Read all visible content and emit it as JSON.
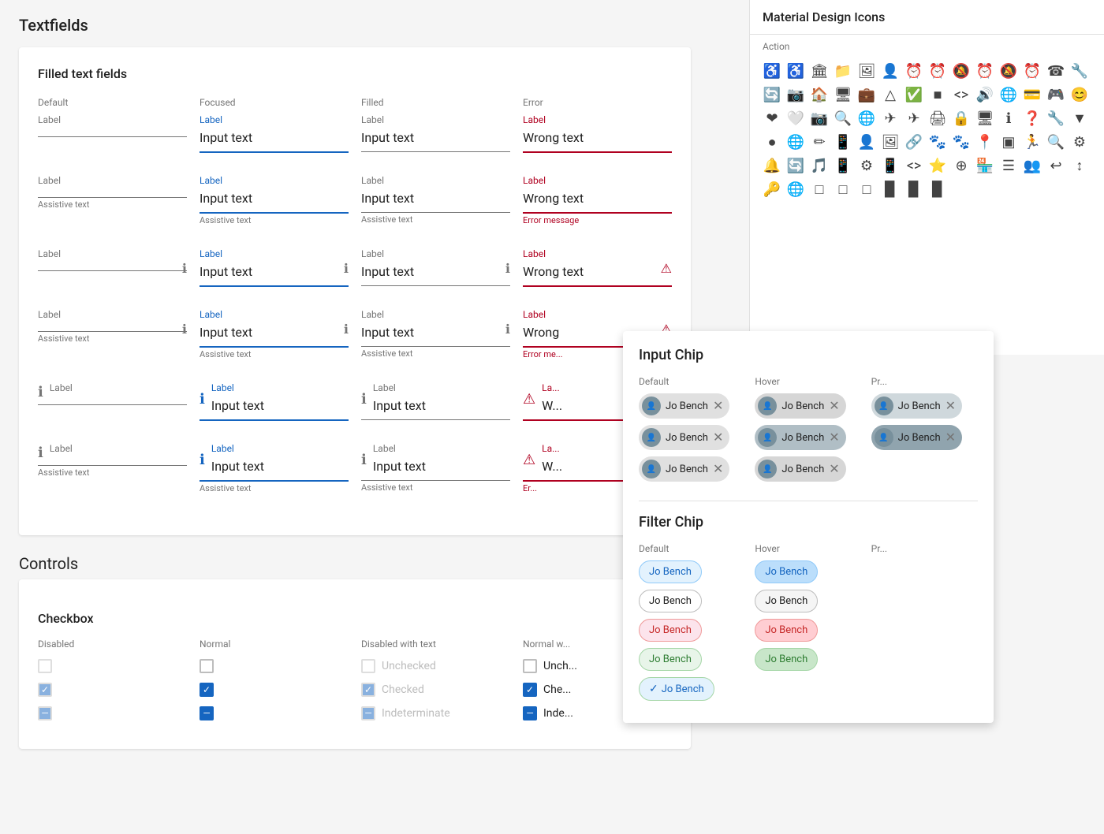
{
  "page": {
    "title": "Textfields"
  },
  "filled_section": {
    "title": "Filled text fields",
    "columns": [
      "Default",
      "Focused",
      "Filled",
      "Error"
    ]
  },
  "rows": [
    {
      "id": "row1",
      "fields": [
        {
          "state": "default",
          "label": "Label",
          "value": "",
          "underline": "normal",
          "assistive": "",
          "icon": "none",
          "icon_pos": "none"
        },
        {
          "state": "focused",
          "label": "Label",
          "value": "Input text",
          "underline": "focused",
          "assistive": "",
          "icon": "none",
          "icon_pos": "none"
        },
        {
          "state": "filled",
          "label": "Label",
          "value": "Input text",
          "underline": "normal",
          "assistive": "",
          "icon": "none",
          "icon_pos": "none"
        },
        {
          "state": "error",
          "label": "Label",
          "value": "Wrong text",
          "underline": "error",
          "assistive": "",
          "icon": "none",
          "icon_pos": "none"
        }
      ]
    },
    {
      "id": "row2",
      "fields": [
        {
          "state": "default",
          "label": "Label",
          "value": "",
          "underline": "normal",
          "assistive": "Assistive text",
          "icon": "none",
          "icon_pos": "none"
        },
        {
          "state": "focused",
          "label": "Label",
          "value": "Input text",
          "underline": "focused",
          "assistive": "Assistive text",
          "icon": "none",
          "icon_pos": "none"
        },
        {
          "state": "filled",
          "label": "Label",
          "value": "Input text",
          "underline": "normal",
          "assistive": "Assistive text",
          "icon": "none",
          "icon_pos": "none"
        },
        {
          "state": "error",
          "label": "Label",
          "value": "Wrong text",
          "underline": "error",
          "assistive": "Error message",
          "icon": "none",
          "icon_pos": "none"
        }
      ]
    },
    {
      "id": "row3",
      "fields": [
        {
          "state": "default",
          "label": "Label",
          "value": "",
          "underline": "normal",
          "assistive": "",
          "icon": "info",
          "icon_pos": "trailing"
        },
        {
          "state": "focused",
          "label": "Label",
          "value": "Input text",
          "underline": "focused",
          "assistive": "",
          "icon": "info",
          "icon_pos": "trailing"
        },
        {
          "state": "filled",
          "label": "Label",
          "value": "Input text",
          "underline": "normal",
          "assistive": "",
          "icon": "info",
          "icon_pos": "trailing"
        },
        {
          "state": "error",
          "label": "Label",
          "value": "Wrong text",
          "underline": "error",
          "assistive": "",
          "icon": "error",
          "icon_pos": "trailing"
        }
      ]
    },
    {
      "id": "row4",
      "fields": [
        {
          "state": "default",
          "label": "Label",
          "value": "",
          "underline": "normal",
          "assistive": "Assistive text",
          "icon": "info",
          "icon_pos": "trailing"
        },
        {
          "state": "focused",
          "label": "Label",
          "value": "Input text",
          "underline": "focused",
          "assistive": "Assistive text",
          "icon": "info",
          "icon_pos": "trailing"
        },
        {
          "state": "filled",
          "label": "Label",
          "value": "Input text",
          "underline": "normal",
          "assistive": "Assistive text",
          "icon": "info",
          "icon_pos": "trailing"
        },
        {
          "state": "error",
          "label": "Label",
          "value": "Wrong",
          "underline": "error",
          "assistive": "Error me...",
          "icon": "error",
          "icon_pos": "trailing"
        }
      ]
    },
    {
      "id": "row5",
      "fields": [
        {
          "state": "default",
          "label": "Label",
          "value": "",
          "underline": "normal",
          "assistive": "",
          "icon": "info",
          "icon_pos": "leading"
        },
        {
          "state": "focused",
          "label": "Label",
          "value": "Input text",
          "underline": "focused",
          "assistive": "",
          "icon": "info",
          "icon_pos": "leading"
        },
        {
          "state": "filled",
          "label": "Label",
          "value": "Input text",
          "underline": "normal",
          "assistive": "",
          "icon": "info",
          "icon_pos": "leading"
        },
        {
          "state": "error",
          "label": "La...",
          "value": "W...",
          "underline": "error",
          "assistive": "",
          "icon": "error",
          "icon_pos": "leading"
        }
      ]
    },
    {
      "id": "row6",
      "fields": [
        {
          "state": "default",
          "label": "Label",
          "value": "",
          "underline": "normal",
          "assistive": "Assistive text",
          "icon": "info",
          "icon_pos": "leading"
        },
        {
          "state": "focused",
          "label": "Label",
          "value": "Input text",
          "underline": "focused",
          "assistive": "Assistive text",
          "icon": "info",
          "icon_pos": "leading"
        },
        {
          "state": "filled",
          "label": "Label",
          "value": "Input text",
          "underline": "normal",
          "assistive": "Assistive text",
          "icon": "info",
          "icon_pos": "leading"
        },
        {
          "state": "error",
          "label": "La...",
          "value": "W...",
          "underline": "error",
          "assistive": "Er...",
          "icon": "error",
          "icon_pos": "leading"
        }
      ]
    }
  ],
  "icons_panel": {
    "title": "Material Design Icons",
    "section_label": "Action",
    "icons": [
      "♿",
      "♿",
      "🏛",
      "📁",
      "🖼",
      "👤",
      "⏰",
      "⏰",
      "🔕",
      "⏰",
      "🔕",
      "⏰",
      "☎",
      "🔧",
      "🔄",
      "📷",
      "🏠",
      "🖥",
      "💼",
      "△",
      "✅",
      "▣",
      "<>",
      "🔊",
      "🌐",
      "💳",
      "🎮",
      "😊",
      "❤",
      "🤍",
      "📷",
      "🔍",
      "🌐",
      "✈",
      "✈",
      "🖨",
      "🔒",
      "🖥",
      "ℹ",
      "❓",
      "🔧",
      "▼",
      "●",
      "🌐",
      "🖊",
      "📱",
      "👤",
      "🖼",
      "🔗",
      "🐾",
      "🐾",
      "📍",
      "▣",
      "🏃",
      "🔍",
      "⚙",
      "🔔",
      "🔄",
      "🎵",
      "📱",
      "⚙",
      "📱",
      "<>",
      "⭐",
      "⊕",
      "🏪",
      "☰",
      "👥",
      "↩",
      "↕",
      "🔑",
      "🌐",
      "□",
      "□",
      "□",
      "▉",
      "▉",
      "▉"
    ]
  },
  "chip_panel": {
    "title": "Input Chip",
    "columns": [
      "Default",
      "Hover",
      "Pr..."
    ],
    "input_chips": [
      {
        "col": 0,
        "label": "Jo Bench",
        "selected": false,
        "has_avatar": true
      },
      {
        "col": 0,
        "label": "Jo Bench",
        "selected": false,
        "has_avatar": true
      },
      {
        "col": 0,
        "label": "Jo Bench",
        "selected": false,
        "has_avatar": true
      },
      {
        "col": 1,
        "label": "Jo Bench",
        "selected": false,
        "hovered": true,
        "has_avatar": true
      },
      {
        "col": 1,
        "label": "Jo Bench",
        "selected": true,
        "hovered": true,
        "has_avatar": true
      },
      {
        "col": 1,
        "label": "Jo Bench",
        "selected": false,
        "hovered": true,
        "has_avatar": true
      }
    ],
    "filter_title": "Filter Chip",
    "filter_columns": [
      "Default",
      "Hover",
      "Pr..."
    ],
    "filter_chips": [
      {
        "col": 0,
        "label": "Jo Bench",
        "variant": "blue",
        "selected": false
      },
      {
        "col": 0,
        "label": "Jo Bench",
        "variant": "neutral",
        "selected": false
      },
      {
        "col": 0,
        "label": "Jo Bench",
        "variant": "red",
        "selected": false
      },
      {
        "col": 0,
        "label": "Jo Bench",
        "variant": "green",
        "selected": false
      },
      {
        "col": 0,
        "label": "Jo Bench",
        "variant": "green",
        "selected": true
      },
      {
        "col": 1,
        "label": "Jo Bench",
        "variant": "blue",
        "hovered": true
      },
      {
        "col": 1,
        "label": "Jo Bench",
        "variant": "neutral",
        "hovered": true
      },
      {
        "col": 1,
        "label": "Jo Bench",
        "variant": "red",
        "hovered": true
      },
      {
        "col": 1,
        "label": "Jo Bench",
        "variant": "green",
        "hovered": true
      }
    ]
  },
  "controls": {
    "title": "Controls",
    "checkbox": {
      "title": "Checkbox",
      "columns": [
        "Disabled",
        "Normal",
        "Disabled with text",
        "Normal w..."
      ],
      "rows": [
        {
          "states": [
            "unchecked-disabled",
            "unchecked",
            "unchecked-text",
            "unchecked-text"
          ],
          "labels": [
            "",
            "",
            "Unchecked",
            "Unch..."
          ]
        },
        {
          "states": [
            "checked-disabled",
            "checked",
            "checked-text",
            "checked-text"
          ],
          "labels": [
            "",
            "",
            "Checked",
            "Che..."
          ]
        },
        {
          "states": [
            "indeterminate-disabled",
            "indeterminate",
            "indeterminate-text",
            "indeterminate-text"
          ],
          "labels": [
            "",
            "",
            "Indeterminate",
            "Inde...  "
          ]
        }
      ]
    }
  }
}
